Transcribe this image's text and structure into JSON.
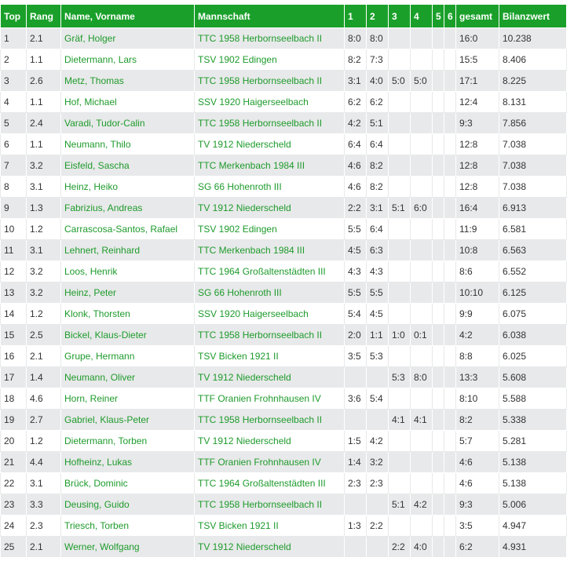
{
  "headers": {
    "top": "Top",
    "rang": "Rang",
    "name": "Name, Vorname",
    "mannschaft": "Mannschaft",
    "s1": "1",
    "s2": "2",
    "s3": "3",
    "s4": "4",
    "s5": "5",
    "s6": "6",
    "gesamt": "gesamt",
    "bilanzwert": "Bilanzwert"
  },
  "colors": {
    "header_bg": "#1aa02a",
    "link": "#1e9b2c",
    "row_alt": "#e8e9ea"
  },
  "rows": [
    {
      "top": "1",
      "rang": "2.1",
      "name": "Gräf, Holger",
      "team": "TTC 1958 Herbornseelbach II",
      "s1": "8:0",
      "s2": "8:0",
      "s3": "",
      "s4": "",
      "s5": "",
      "s6": "",
      "gesamt": "16:0",
      "bilanzwert": "10.238"
    },
    {
      "top": "2",
      "rang": "1.1",
      "name": "Dietermann, Lars",
      "team": "TSV 1902 Edingen",
      "s1": "8:2",
      "s2": "7:3",
      "s3": "",
      "s4": "",
      "s5": "",
      "s6": "",
      "gesamt": "15:5",
      "bilanzwert": "8.406"
    },
    {
      "top": "3",
      "rang": "2.6",
      "name": "Metz, Thomas",
      "team": "TTC 1958 Herbornseelbach II",
      "s1": "3:1",
      "s2": "4:0",
      "s3": "5:0",
      "s4": "5:0",
      "s5": "",
      "s6": "",
      "gesamt": "17:1",
      "bilanzwert": "8.225"
    },
    {
      "top": "4",
      "rang": "1.1",
      "name": "Hof, Michael",
      "team": "SSV 1920 Haigerseelbach",
      "s1": "6:2",
      "s2": "6:2",
      "s3": "",
      "s4": "",
      "s5": "",
      "s6": "",
      "gesamt": "12:4",
      "bilanzwert": "8.131"
    },
    {
      "top": "5",
      "rang": "2.4",
      "name": "Varadi, Tudor-Calin",
      "team": "TTC 1958 Herbornseelbach II",
      "s1": "4:2",
      "s2": "5:1",
      "s3": "",
      "s4": "",
      "s5": "",
      "s6": "",
      "gesamt": "9:3",
      "bilanzwert": "7.856"
    },
    {
      "top": "6",
      "rang": "1.1",
      "name": "Neumann, Thilo",
      "team": "TV 1912 Niederscheld",
      "s1": "6:4",
      "s2": "6:4",
      "s3": "",
      "s4": "",
      "s5": "",
      "s6": "",
      "gesamt": "12:8",
      "bilanzwert": "7.038"
    },
    {
      "top": "7",
      "rang": "3.2",
      "name": "Eisfeld, Sascha",
      "team": "TTC Merkenbach 1984 III",
      "s1": "4:6",
      "s2": "8:2",
      "s3": "",
      "s4": "",
      "s5": "",
      "s6": "",
      "gesamt": "12:8",
      "bilanzwert": "7.038"
    },
    {
      "top": "8",
      "rang": "3.1",
      "name": "Heinz, Heiko",
      "team": "SG 66 Hohenroth III",
      "s1": "4:6",
      "s2": "8:2",
      "s3": "",
      "s4": "",
      "s5": "",
      "s6": "",
      "gesamt": "12:8",
      "bilanzwert": "7.038"
    },
    {
      "top": "9",
      "rang": "1.3",
      "name": "Fabrizius, Andreas",
      "team": "TV 1912 Niederscheld",
      "s1": "2:2",
      "s2": "3:1",
      "s3": "5:1",
      "s4": "6:0",
      "s5": "",
      "s6": "",
      "gesamt": "16:4",
      "bilanzwert": "6.913"
    },
    {
      "top": "10",
      "rang": "1.2",
      "name": "Carrascosa-Santos, Rafael",
      "team": "TSV 1902 Edingen",
      "s1": "5:5",
      "s2": "6:4",
      "s3": "",
      "s4": "",
      "s5": "",
      "s6": "",
      "gesamt": "11:9",
      "bilanzwert": "6.581"
    },
    {
      "top": "11",
      "rang": "3.1",
      "name": "Lehnert, Reinhard",
      "team": "TTC Merkenbach 1984 III",
      "s1": "4:5",
      "s2": "6:3",
      "s3": "",
      "s4": "",
      "s5": "",
      "s6": "",
      "gesamt": "10:8",
      "bilanzwert": "6.563"
    },
    {
      "top": "12",
      "rang": "3.2",
      "name": "Loos, Henrik",
      "team": "TTC 1964 Großaltenstädten III",
      "s1": "4:3",
      "s2": "4:3",
      "s3": "",
      "s4": "",
      "s5": "",
      "s6": "",
      "gesamt": "8:6",
      "bilanzwert": "6.552"
    },
    {
      "top": "13",
      "rang": "3.2",
      "name": "Heinz, Peter",
      "team": "SG 66 Hohenroth III",
      "s1": "5:5",
      "s2": "5:5",
      "s3": "",
      "s4": "",
      "s5": "",
      "s6": "",
      "gesamt": "10:10",
      "bilanzwert": "6.125"
    },
    {
      "top": "14",
      "rang": "1.2",
      "name": "Klonk, Thorsten",
      "team": "SSV 1920 Haigerseelbach",
      "s1": "5:4",
      "s2": "4:5",
      "s3": "",
      "s4": "",
      "s5": "",
      "s6": "",
      "gesamt": "9:9",
      "bilanzwert": "6.075"
    },
    {
      "top": "15",
      "rang": "2.5",
      "name": "Bickel, Klaus-Dieter",
      "team": "TTC 1958 Herbornseelbach II",
      "s1": "2:0",
      "s2": "1:1",
      "s3": "1:0",
      "s4": "0:1",
      "s5": "",
      "s6": "",
      "gesamt": "4:2",
      "bilanzwert": "6.038"
    },
    {
      "top": "16",
      "rang": "2.1",
      "name": "Grupe, Hermann",
      "team": "TSV Bicken 1921 II",
      "s1": "3:5",
      "s2": "5:3",
      "s3": "",
      "s4": "",
      "s5": "",
      "s6": "",
      "gesamt": "8:8",
      "bilanzwert": "6.025"
    },
    {
      "top": "17",
      "rang": "1.4",
      "name": "Neumann, Oliver",
      "team": "TV 1912 Niederscheld",
      "s1": "",
      "s2": "",
      "s3": "5:3",
      "s4": "8:0",
      "s5": "",
      "s6": "",
      "gesamt": "13:3",
      "bilanzwert": "5.608"
    },
    {
      "top": "18",
      "rang": "4.6",
      "name": "Horn, Reiner",
      "team": "TTF Oranien Frohnhausen IV",
      "s1": "3:6",
      "s2": "5:4",
      "s3": "",
      "s4": "",
      "s5": "",
      "s6": "",
      "gesamt": "8:10",
      "bilanzwert": "5.588"
    },
    {
      "top": "19",
      "rang": "2.7",
      "name": "Gabriel, Klaus-Peter",
      "team": "TTC 1958 Herbornseelbach II",
      "s1": "",
      "s2": "",
      "s3": "4:1",
      "s4": "4:1",
      "s5": "",
      "s6": "",
      "gesamt": "8:2",
      "bilanzwert": "5.338"
    },
    {
      "top": "20",
      "rang": "1.2",
      "name": "Dietermann, Torben",
      "team": "TV 1912 Niederscheld",
      "s1": "1:5",
      "s2": "4:2",
      "s3": "",
      "s4": "",
      "s5": "",
      "s6": "",
      "gesamt": "5:7",
      "bilanzwert": "5.281"
    },
    {
      "top": "21",
      "rang": "4.4",
      "name": "Hofheinz, Lukas",
      "team": "TTF Oranien Frohnhausen IV",
      "s1": "1:4",
      "s2": "3:2",
      "s3": "",
      "s4": "",
      "s5": "",
      "s6": "",
      "gesamt": "4:6",
      "bilanzwert": "5.138"
    },
    {
      "top": "22",
      "rang": "3.1",
      "name": "Brück, Dominic",
      "team": "TTC 1964 Großaltenstädten III",
      "s1": "2:3",
      "s2": "2:3",
      "s3": "",
      "s4": "",
      "s5": "",
      "s6": "",
      "gesamt": "4:6",
      "bilanzwert": "5.138"
    },
    {
      "top": "23",
      "rang": "3.3",
      "name": "Deusing, Guido",
      "team": "TTC 1958 Herbornseelbach II",
      "s1": "",
      "s2": "",
      "s3": "5:1",
      "s4": "4:2",
      "s5": "",
      "s6": "",
      "gesamt": "9:3",
      "bilanzwert": "5.006"
    },
    {
      "top": "24",
      "rang": "2.3",
      "name": "Triesch, Torben",
      "team": "TSV Bicken 1921 II",
      "s1": "1:3",
      "s2": "2:2",
      "s3": "",
      "s4": "",
      "s5": "",
      "s6": "",
      "gesamt": "3:5",
      "bilanzwert": "4.947"
    },
    {
      "top": "25",
      "rang": "2.1",
      "name": "Werner, Wolfgang",
      "team": "TV 1912 Niederscheld",
      "s1": "",
      "s2": "",
      "s3": "2:2",
      "s4": "4:0",
      "s5": "",
      "s6": "",
      "gesamt": "6:2",
      "bilanzwert": "4.931"
    }
  ]
}
